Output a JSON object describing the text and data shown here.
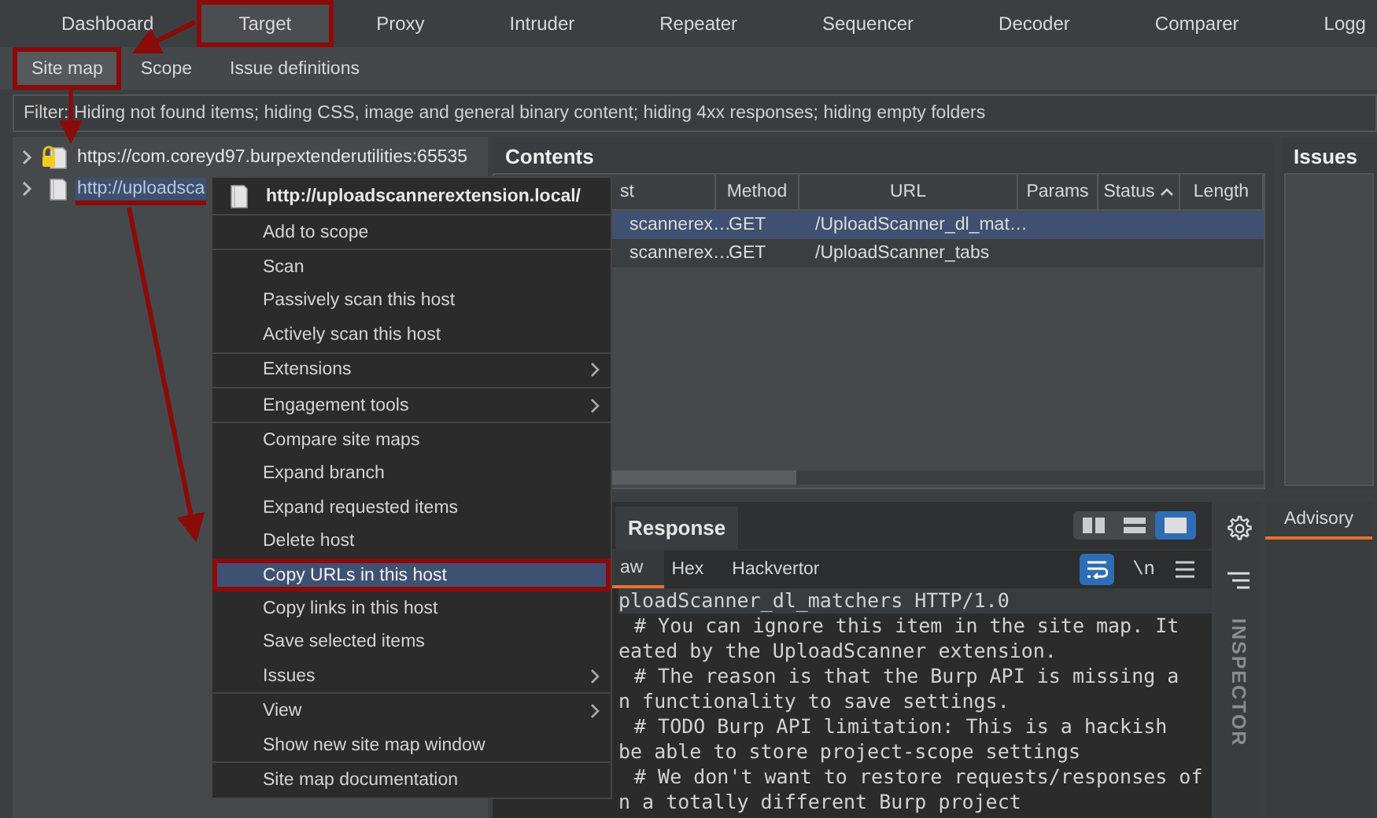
{
  "main_tabs": [
    {
      "label": "Dashboard",
      "selected": false,
      "annotated": false
    },
    {
      "label": "Target",
      "selected": true,
      "annotated": true
    },
    {
      "label": "Proxy",
      "selected": false,
      "annotated": false
    },
    {
      "label": "Intruder",
      "selected": false,
      "annotated": false
    },
    {
      "label": "Repeater",
      "selected": false,
      "annotated": false
    },
    {
      "label": "Sequencer",
      "selected": false,
      "annotated": false
    },
    {
      "label": "Decoder",
      "selected": false,
      "annotated": false
    },
    {
      "label": "Comparer",
      "selected": false,
      "annotated": false
    },
    {
      "label": "Logg",
      "selected": false,
      "annotated": false
    }
  ],
  "sub_tabs": [
    {
      "label": "Site map",
      "selected": true,
      "annotated": true
    },
    {
      "label": "Scope",
      "selected": false,
      "annotated": false
    },
    {
      "label": "Issue definitions",
      "selected": false,
      "annotated": false
    }
  ],
  "filter": "Filter: Hiding not found items;  hiding CSS, image and general binary content;  hiding 4xx responses;  hiding empty folders",
  "site_tree": [
    {
      "label": "https://com.coreyd97.burpextenderutilities:65535",
      "secure": true,
      "selected": false
    },
    {
      "label": "http://uploadsca",
      "secure": false,
      "selected": true
    }
  ],
  "contents": {
    "title": "Contents",
    "columns": [
      "st",
      "Method",
      "URL",
      "Params",
      "Status",
      "Length"
    ],
    "rows": [
      {
        "cells": [
          "scannerex…",
          "GET",
          "/UploadScanner_dl_mat…"
        ],
        "selected": true
      },
      {
        "cells": [
          "scannerex…",
          "GET",
          "/UploadScanner_tabs"
        ],
        "selected": false
      }
    ]
  },
  "issues": {
    "title": "Issues"
  },
  "response": {
    "title": "Response",
    "view_modes": [
      {
        "kind": "columns",
        "selected": false
      },
      {
        "kind": "rows",
        "selected": false
      },
      {
        "kind": "single",
        "selected": true
      }
    ],
    "tabs": [
      {
        "label": "aw",
        "selected": true
      },
      {
        "label": "Hex",
        "selected": false
      },
      {
        "label": "Hackvertor",
        "selected": false
      }
    ],
    "wrap_on": true,
    "newline_label": "\\n",
    "lines": [
      {
        "text": "ploadScanner_dl_matchers HTTP/1.0",
        "indented": false,
        "highlighted": true
      },
      {
        "text": "# You can ignore this item in the site map. It",
        "indented": true,
        "highlighted": false
      },
      {
        "text": "eated by the UploadScanner extension.",
        "indented": false,
        "highlighted": false
      },
      {
        "text": "# The reason is that the Burp API is missing a",
        "indented": true,
        "highlighted": false
      },
      {
        "text": "n functionality to save settings.",
        "indented": false,
        "highlighted": false
      },
      {
        "text": "# TODO Burp API limitation: This is a hackish",
        "indented": true,
        "highlighted": false
      },
      {
        "text": "be able to store project-scope settings",
        "indented": false,
        "highlighted": false
      },
      {
        "text": "# We don't want to restore requests/responses of",
        "indented": true,
        "highlighted": false
      },
      {
        "text": "n a totally different Burp project",
        "indented": false,
        "highlighted": false
      }
    ]
  },
  "inspector": {
    "label": "INSPECTOR"
  },
  "advisory": {
    "tabs": [
      {
        "label": "Advisory",
        "selected": true
      }
    ]
  },
  "context_menu": {
    "header": "http://uploadscannerextension.local/",
    "groups": [
      [
        {
          "label": "Add to scope",
          "submenu": false,
          "selected": false,
          "annotated": false
        }
      ],
      [
        {
          "label": "Scan",
          "submenu": false,
          "selected": false,
          "annotated": false
        },
        {
          "label": "Passively scan this host",
          "submenu": false,
          "selected": false,
          "annotated": false
        },
        {
          "label": "Actively scan this host",
          "submenu": false,
          "selected": false,
          "annotated": false
        }
      ],
      [
        {
          "label": "Extensions",
          "submenu": true,
          "selected": false,
          "annotated": false
        }
      ],
      [
        {
          "label": "Engagement tools",
          "submenu": true,
          "selected": false,
          "annotated": false
        }
      ],
      [
        {
          "label": "Compare site maps",
          "submenu": false,
          "selected": false,
          "annotated": false
        },
        {
          "label": "Expand branch",
          "submenu": false,
          "selected": false,
          "annotated": false
        },
        {
          "label": "Expand requested items",
          "submenu": false,
          "selected": false,
          "annotated": false
        },
        {
          "label": "Delete host",
          "submenu": false,
          "selected": false,
          "annotated": false
        },
        {
          "label": "Copy URLs in this host",
          "submenu": false,
          "selected": true,
          "annotated": true
        },
        {
          "label": "Copy links in this host",
          "submenu": false,
          "selected": false,
          "annotated": false
        },
        {
          "label": "Save selected items",
          "submenu": false,
          "selected": false,
          "annotated": false
        },
        {
          "label": "Issues",
          "submenu": true,
          "selected": false,
          "annotated": false
        }
      ],
      [
        {
          "label": "View",
          "submenu": true,
          "selected": false,
          "annotated": false
        },
        {
          "label": "Show new site map window",
          "submenu": false,
          "selected": false,
          "annotated": false
        }
      ],
      [
        {
          "label": "Site map documentation",
          "submenu": false,
          "selected": false,
          "annotated": false
        }
      ]
    ]
  }
}
